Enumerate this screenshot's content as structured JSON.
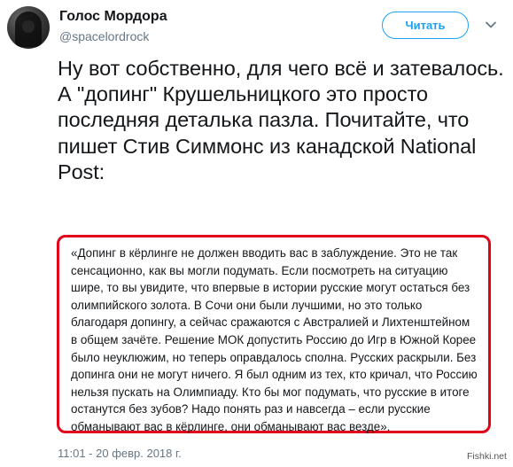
{
  "account": {
    "display_name": "Голос Мордора",
    "handle": "@spacelordrock"
  },
  "follow_button": {
    "label": "Читать"
  },
  "tweet": {
    "text": "Ну вот собственно, для чего всё и затевалось. А \"допинг\" Крушельницкого это просто последняя деталька пазла. Почитайте, что пишет Стив Симмонс из канадской National Post:",
    "quote": "«Допинг в кёрлинге не должен вводить вас в заблуждение. Это не так сенсационно, как вы могли подумать. Если посмотреть на ситуацию шире, то вы увидите, что впервые в истории русские могут остаться без олимпийского золота. В Сочи они были лучшими, но это только благодаря допингу, а сейчас сражаются с Австралией и Лихтенштейном в общем зачёте. Решение МОК допустить Россию до Игр в Южной Корее было неуклюжим, но теперь оправдалось сполна. Русских раскрыли. Без допинга они не могут ничего. Я был одним из тех, кто кричал, что Россию нельзя пускать на Олимпиаду. Кто бы мог подумать, что русские в итоге останутся без зубов? Надо понять раз и навсегда – если русские обманывают вас в кёрлинге, они обманывают вас везде».",
    "timestamp": "11:01 - 20 февр. 2018 г."
  },
  "watermark": {
    "text": "Fishki.net"
  },
  "colors": {
    "accent": "#1da1f2",
    "highlight_border": "#e3001b",
    "secondary_text": "#657786",
    "primary_text": "#14171a"
  },
  "icons": {
    "avatar": "avatar-photo",
    "menu": "chevron-down-icon"
  }
}
